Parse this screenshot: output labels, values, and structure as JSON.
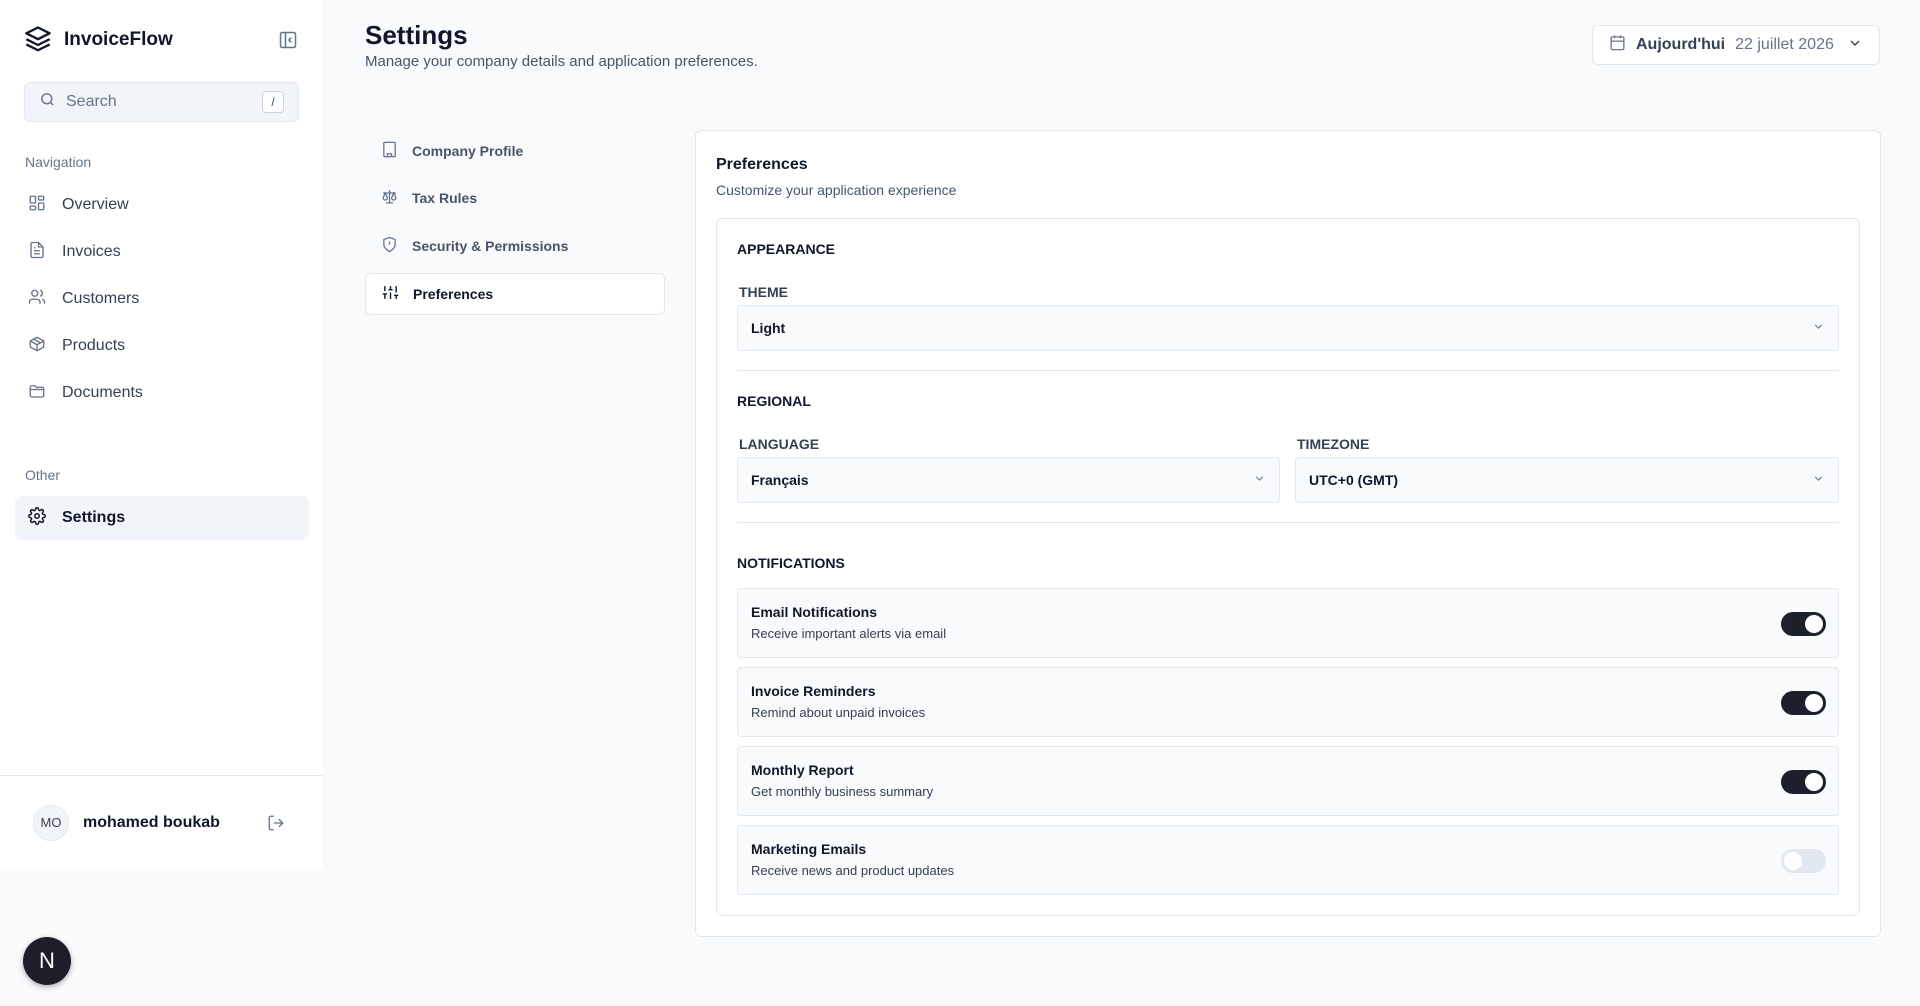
{
  "app": {
    "name": "InvoiceFlow"
  },
  "search": {
    "placeholder": "Search",
    "shortcut": "/"
  },
  "sidebar": {
    "nav_heading": "Navigation",
    "items": [
      {
        "label": "Overview"
      },
      {
        "label": "Invoices"
      },
      {
        "label": "Customers"
      },
      {
        "label": "Products"
      },
      {
        "label": "Documents"
      }
    ],
    "other_heading": "Other",
    "settings_label": "Settings"
  },
  "user": {
    "initials": "MO",
    "name": "mohamed boukab"
  },
  "badge": {
    "letter": "N"
  },
  "header": {
    "title": "Settings",
    "subtitle": "Manage your company details and application preferences.",
    "date_today": "Aujourd'hui",
    "date_value": "22 juillet 2026"
  },
  "tabs": [
    {
      "label": "Company Profile"
    },
    {
      "label": "Tax Rules"
    },
    {
      "label": "Security & Permissions"
    },
    {
      "label": "Preferences"
    }
  ],
  "preferences": {
    "title": "Preferences",
    "subtitle": "Customize your application experience",
    "appearance": {
      "heading": "APPEARANCE",
      "theme_label": "THEME",
      "theme_value": "Light"
    },
    "regional": {
      "heading": "REGIONAL",
      "language_label": "LANGUAGE",
      "language_value": "Français",
      "timezone_label": "TIMEZONE",
      "timezone_value": "UTC+0 (GMT)"
    },
    "notifications": {
      "heading": "NOTIFICATIONS",
      "items": [
        {
          "title": "Email Notifications",
          "desc": "Receive important alerts via email",
          "enabled": true
        },
        {
          "title": "Invoice Reminders",
          "desc": "Remind about unpaid invoices",
          "enabled": true
        },
        {
          "title": "Monthly Report",
          "desc": "Get monthly business summary",
          "enabled": true
        },
        {
          "title": "Marketing Emails",
          "desc": "Receive news and product updates",
          "enabled": false
        }
      ]
    }
  },
  "colors": {
    "toggle_on": "#1a202c",
    "toggle_off": "#e2e8f0",
    "accent": "#0f172a"
  }
}
